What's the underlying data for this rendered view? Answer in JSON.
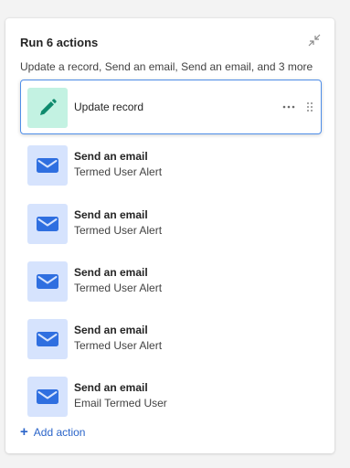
{
  "panel": {
    "title": "Run 6 actions",
    "summary": "Update a record, Send an email, Send an email, and 3 more",
    "add_action_label": "Add action",
    "add_action_icon": "plus-icon"
  },
  "actions": [
    {
      "title": "Update record",
      "subtitle": "",
      "icon": "pencil-icon",
      "selected": true
    },
    {
      "title": "Send an email",
      "subtitle": "Termed User Alert",
      "icon": "mail-icon"
    },
    {
      "title": "Send an email",
      "subtitle": "Termed User Alert",
      "icon": "mail-icon"
    },
    {
      "title": "Send an email",
      "subtitle": "Termed User Alert",
      "icon": "mail-icon"
    },
    {
      "title": "Send an email",
      "subtitle": "Termed User Alert",
      "icon": "mail-icon"
    },
    {
      "title": "Send an email",
      "subtitle": "Email Termed User",
      "icon": "mail-icon"
    }
  ],
  "colors": {
    "update_icon_bg": "#c3f2e2",
    "update_icon_fg": "#0f8a6d",
    "email_icon_bg": "#d6e3fd",
    "email_icon_fg": "#2f6fe0",
    "accent": "#2a64c9",
    "selected_border": "#4f8ee8"
  }
}
